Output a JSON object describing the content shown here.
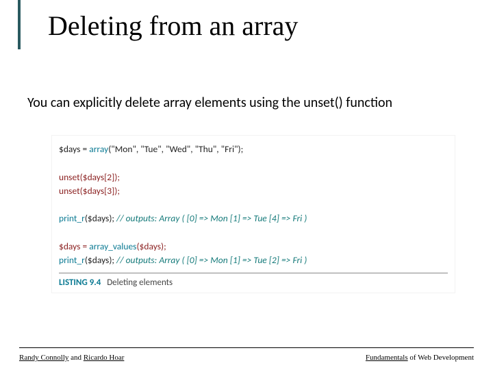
{
  "title": "Deleting from an array",
  "body_text": "You can explicitly delete array elements using the unset() function",
  "code": {
    "l1_a": "$days = ",
    "l1_b": "array",
    "l1_c": "(\"Mon\", \"Tue\", \"Wed\", \"Thu\", \"Fri\");",
    "l2": "unset($days[2]);",
    "l3": "unset($days[3]);",
    "l4_a": "print_r",
    "l4_b": "($days); ",
    "l4_c": "// outputs: Array ( [0] => Mon [1] => Tue [4] => Fri )",
    "l5_a": "$days = ",
    "l5_b": "array_values",
    "l5_c": "($days);",
    "l6_a": "print_r",
    "l6_b": "($days); ",
    "l6_c": "// outputs: Array ( [0] => Mon [1] => Tue [2] => Fri )"
  },
  "listing": {
    "number": "LISTING 9.4",
    "title": "Deleting elements"
  },
  "footer": {
    "left_a": "Randy Connolly",
    "left_b": " and ",
    "left_c": "Ricardo Hoar",
    "right_a": "Fundamentals",
    "right_b": " of Web Development"
  }
}
